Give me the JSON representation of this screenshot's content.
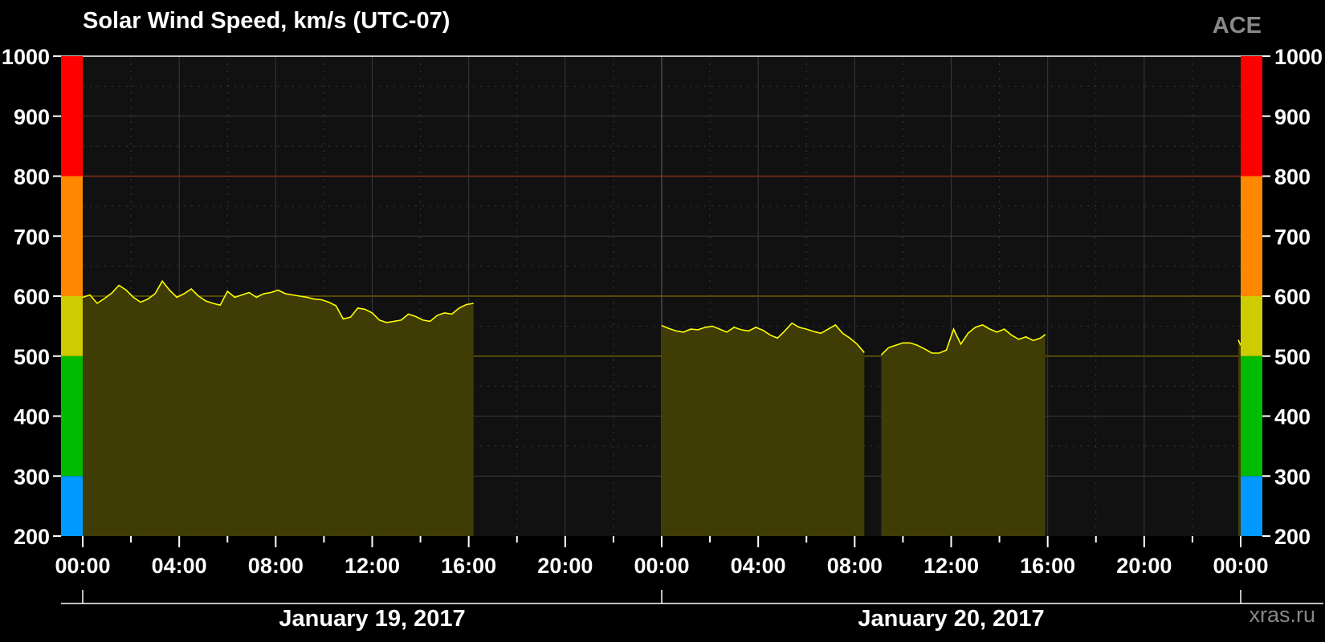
{
  "title": "Solar Wind Speed, km/s (UTC-07)",
  "source_label": "ACE",
  "credit": "xras.ru",
  "chart_data": {
    "type": "area",
    "ylim": [
      200,
      1000
    ],
    "y_ticks": [
      "200",
      "300",
      "400",
      "500",
      "600",
      "700",
      "800",
      "900",
      "1000"
    ],
    "x_range_hours": [
      0,
      48
    ],
    "x_tick_labels": [
      "00:00",
      "04:00",
      "08:00",
      "12:00",
      "16:00",
      "20:00",
      "00:00",
      "04:00",
      "08:00",
      "12:00",
      "16:00",
      "20:00",
      "00:00"
    ],
    "date_labels": [
      "January 19, 2017",
      "January 20, 2017"
    ],
    "threshold_lines": [
      500,
      600,
      800
    ],
    "color_bands": [
      {
        "from": 200,
        "to": 300,
        "color": "#0099ff"
      },
      {
        "from": 300,
        "to": 500,
        "color": "#00bb00"
      },
      {
        "from": 500,
        "to": 600,
        "color": "#cccc00"
      },
      {
        "from": 600,
        "to": 800,
        "color": "#ff8800"
      },
      {
        "from": 800,
        "to": 1000,
        "color": "#ff0000"
      }
    ],
    "line_color": "#ffff00",
    "fill_color": "#403c06",
    "segments": [
      {
        "points": [
          [
            0.0,
            598
          ],
          [
            0.3,
            602
          ],
          [
            0.6,
            588
          ],
          [
            0.9,
            596
          ],
          [
            1.2,
            605
          ],
          [
            1.5,
            618
          ],
          [
            1.8,
            610
          ],
          [
            2.1,
            598
          ],
          [
            2.4,
            590
          ],
          [
            2.7,
            595
          ],
          [
            3.0,
            604
          ],
          [
            3.3,
            625
          ],
          [
            3.6,
            610
          ],
          [
            3.9,
            598
          ],
          [
            4.2,
            604
          ],
          [
            4.5,
            612
          ],
          [
            4.8,
            600
          ],
          [
            5.1,
            592
          ],
          [
            5.4,
            588
          ],
          [
            5.7,
            585
          ],
          [
            6.0,
            608
          ],
          [
            6.3,
            598
          ],
          [
            6.6,
            602
          ],
          [
            6.9,
            606
          ],
          [
            7.2,
            598
          ],
          [
            7.5,
            604
          ],
          [
            7.8,
            606
          ],
          [
            8.1,
            610
          ],
          [
            8.4,
            604
          ],
          [
            8.7,
            602
          ],
          [
            9.0,
            600
          ],
          [
            9.3,
            598
          ],
          [
            9.6,
            595
          ],
          [
            9.9,
            594
          ],
          [
            10.2,
            590
          ],
          [
            10.5,
            584
          ],
          [
            10.8,
            562
          ],
          [
            11.1,
            565
          ],
          [
            11.4,
            580
          ],
          [
            11.7,
            578
          ],
          [
            12.0,
            572
          ],
          [
            12.3,
            560
          ],
          [
            12.6,
            556
          ],
          [
            12.9,
            558
          ],
          [
            13.2,
            560
          ],
          [
            13.5,
            570
          ],
          [
            13.8,
            566
          ],
          [
            14.1,
            560
          ],
          [
            14.4,
            558
          ],
          [
            14.7,
            568
          ],
          [
            15.0,
            572
          ],
          [
            15.3,
            570
          ],
          [
            15.6,
            580
          ],
          [
            15.9,
            586
          ],
          [
            16.2,
            588
          ]
        ]
      },
      {
        "points": [
          [
            24.0,
            551
          ],
          [
            24.3,
            546
          ],
          [
            24.6,
            542
          ],
          [
            24.9,
            540
          ],
          [
            25.2,
            545
          ],
          [
            25.5,
            544
          ],
          [
            25.8,
            548
          ],
          [
            26.1,
            550
          ],
          [
            26.4,
            545
          ],
          [
            26.7,
            540
          ],
          [
            27.0,
            548
          ],
          [
            27.3,
            544
          ],
          [
            27.6,
            542
          ],
          [
            27.9,
            548
          ],
          [
            28.2,
            543
          ],
          [
            28.5,
            535
          ],
          [
            28.8,
            530
          ],
          [
            29.1,
            542
          ],
          [
            29.4,
            555
          ],
          [
            29.7,
            548
          ],
          [
            30.0,
            545
          ],
          [
            30.3,
            541
          ],
          [
            30.6,
            538
          ],
          [
            30.9,
            545
          ],
          [
            31.2,
            552
          ],
          [
            31.5,
            538
          ],
          [
            31.8,
            530
          ],
          [
            32.1,
            520
          ],
          [
            32.4,
            506
          ]
        ]
      },
      {
        "points": [
          [
            33.1,
            502
          ],
          [
            33.4,
            514
          ],
          [
            33.7,
            518
          ],
          [
            34.0,
            522
          ],
          [
            34.3,
            522
          ],
          [
            34.6,
            518
          ],
          [
            34.9,
            512
          ],
          [
            35.2,
            505
          ],
          [
            35.5,
            505
          ],
          [
            35.8,
            510
          ],
          [
            36.1,
            545
          ],
          [
            36.4,
            520
          ],
          [
            36.7,
            538
          ],
          [
            37.0,
            548
          ],
          [
            37.3,
            552
          ],
          [
            37.6,
            545
          ],
          [
            37.9,
            540
          ],
          [
            38.2,
            545
          ],
          [
            38.5,
            535
          ],
          [
            38.8,
            528
          ],
          [
            39.1,
            532
          ],
          [
            39.4,
            526
          ],
          [
            39.7,
            530
          ],
          [
            39.9,
            536
          ]
        ]
      },
      {
        "points": [
          [
            47.9,
            527
          ],
          [
            48.0,
            518
          ]
        ]
      }
    ]
  }
}
